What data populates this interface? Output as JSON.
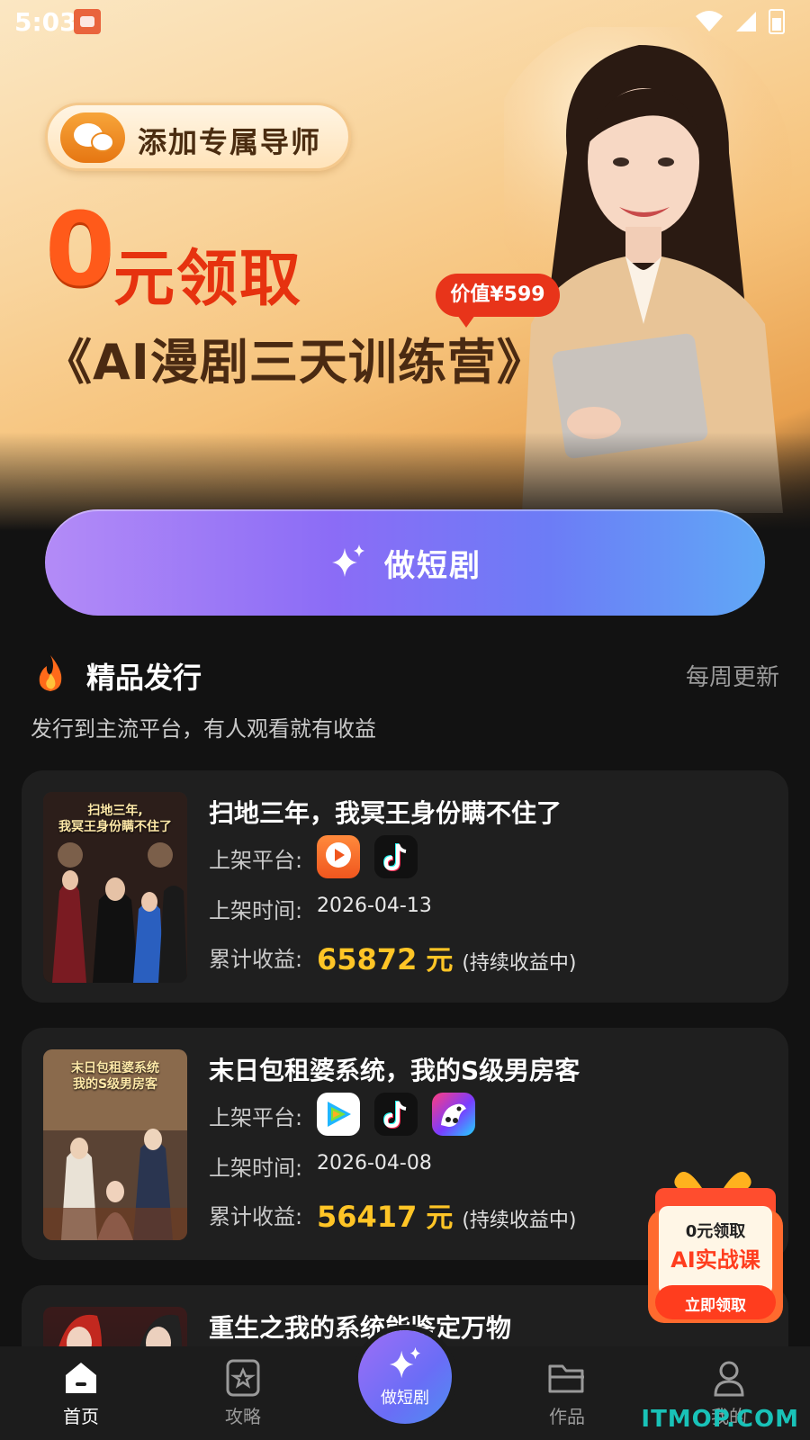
{
  "status_bar": {
    "time": "5:03"
  },
  "banner": {
    "tutor_button": "添加专属导师",
    "promo_zero": "0",
    "promo_claim": "元领取",
    "value_tag": "价值¥599",
    "camp_title": "《AI漫剧三天训练营》"
  },
  "make_button_label": "做短剧",
  "section": {
    "title": "精品发行",
    "more": "每周更新",
    "subtitle": "发行到主流平台，有人观看就有收益"
  },
  "labels": {
    "platform": "上架平台:",
    "date": "上架时间:",
    "earnings": "累计收益:"
  },
  "dramas": [
    {
      "cover_text": "扫地三年,\n我冥王身份瞒不住了",
      "title": "扫地三年，我冥王身份瞒不住了",
      "platforms": [
        "hongguo-icon",
        "douyin-icon"
      ],
      "date": "2026-04-13",
      "earnings": "65872",
      "unit": "元",
      "note": "(持续收益中)"
    },
    {
      "cover_text": "末日包租婆系统\n我的S级男房客",
      "title": "末日包租婆系统，我的S级男房客",
      "platforms": [
        "tencent-video-icon",
        "douyin-icon",
        "kuaishou-icon"
      ],
      "date": "2026-04-08",
      "earnings": "56417",
      "unit": "元",
      "note": "(持续收益中)"
    },
    {
      "title": "重生之我的系统能鉴定万物"
    }
  ],
  "float_gift": {
    "line1": "0元领取",
    "line2": "AI实战课",
    "button": "立即领取"
  },
  "nav": {
    "home": "首页",
    "guide": "攻略",
    "center": "做短剧",
    "works": "作品",
    "mine": "我的"
  },
  "watermark": "ITMOP.COM",
  "colors": {
    "accent_purple": "#8b6cf6",
    "earnings_gold": "#ffc526",
    "promo_red": "#e6320f",
    "background": "#121212"
  }
}
